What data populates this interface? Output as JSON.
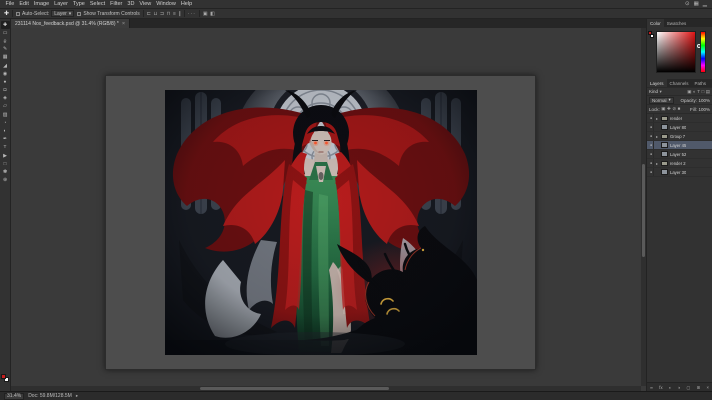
{
  "app": {
    "name": "Adobe Photoshop"
  },
  "menu_bar": {
    "items": [
      "File",
      "Edit",
      "Image",
      "Layer",
      "Type",
      "Select",
      "Filter",
      "3D",
      "View",
      "Window",
      "Help"
    ],
    "right_icons": [
      {
        "name": "search-icon",
        "glyph": "⊙"
      },
      {
        "name": "workspace-switcher-icon",
        "glyph": "▦"
      },
      {
        "name": "minimize-icon",
        "glyph": "▁"
      }
    ]
  },
  "options_bar": {
    "tool_icon_glyph": "✚",
    "auto_select_label": "Auto-Select:",
    "auto_select_value": "Layer",
    "dropdown_caret": "▾",
    "transform_label": "Show Transform Controls",
    "align_icons": [
      {
        "name": "align-left-icon",
        "glyph": "⊏"
      },
      {
        "name": "align-center-horizontal-icon",
        "glyph": "⊔"
      },
      {
        "name": "align-right-icon",
        "glyph": "⊐"
      },
      {
        "name": "align-top-icon",
        "glyph": "⊓"
      },
      {
        "name": "distribute-vertical-icon",
        "glyph": "≡"
      },
      {
        "name": "distribute-horizontal-icon",
        "glyph": "∥"
      }
    ],
    "more_options_glyph": "···",
    "extra_icons": [
      {
        "name": "3d-mode-icon",
        "glyph": "▣"
      },
      {
        "name": "arrange-icon",
        "glyph": "◧"
      }
    ]
  },
  "document_tab": {
    "title": "231114 Nox_feedback.psd @ 31.4% (RGB/8) *",
    "close_glyph": "×"
  },
  "toolbar": {
    "foreground_color": "#c61e1e",
    "background_color": "#ffffff",
    "tools": [
      {
        "name": "move-tool",
        "glyph": "✚",
        "state": "selected"
      },
      {
        "name": "marquee-tool",
        "glyph": "▭"
      },
      {
        "name": "lasso-tool",
        "glyph": "ϱ"
      },
      {
        "name": "quick-selection-tool",
        "glyph": "✎"
      },
      {
        "name": "crop-tool",
        "glyph": "▦"
      },
      {
        "name": "eyedropper-tool",
        "glyph": "◢"
      },
      {
        "name": "healing-brush-tool",
        "glyph": "◉"
      },
      {
        "name": "brush-tool",
        "glyph": "●"
      },
      {
        "name": "clone-stamp-tool",
        "glyph": "◘"
      },
      {
        "name": "history-brush-tool",
        "glyph": "◈"
      },
      {
        "name": "eraser-tool",
        "glyph": "▱"
      },
      {
        "name": "gradient-tool",
        "glyph": "▨"
      },
      {
        "name": "blur-tool",
        "glyph": "◔"
      },
      {
        "name": "dodge-tool",
        "glyph": "◐"
      },
      {
        "name": "pen-tool",
        "glyph": "✒"
      },
      {
        "name": "type-tool",
        "glyph": "T"
      },
      {
        "name": "path-selection-tool",
        "glyph": "▶"
      },
      {
        "name": "shape-tool",
        "glyph": "□"
      },
      {
        "name": "hand-tool",
        "glyph": "✽"
      },
      {
        "name": "zoom-tool",
        "glyph": "⊕"
      }
    ]
  },
  "panels": {
    "color_panel": {
      "tabs": [
        {
          "label": "Color",
          "state": "active"
        },
        {
          "label": "Swatches"
        }
      ],
      "foreground_color": "#c61e1e",
      "background_color": "#ffffff"
    },
    "layers_panel": {
      "tabs": [
        {
          "label": "Layers",
          "state": "active"
        },
        {
          "label": "Channels"
        },
        {
          "label": "Paths"
        }
      ],
      "filter_label": "Kind",
      "filter_caret": "▾",
      "filter_icons": [
        {
          "name": "filter-pixel-layers-icon",
          "glyph": "▣"
        },
        {
          "name": "filter-adjustment-layers-icon",
          "glyph": "◐"
        },
        {
          "name": "filter-type-layers-icon",
          "glyph": "T"
        },
        {
          "name": "filter-shape-layers-icon",
          "glyph": "□"
        },
        {
          "name": "filter-smart-objects-icon",
          "glyph": "▤"
        }
      ],
      "blend_mode": "Normal",
      "blend_caret": "▾",
      "opacity_label": "Opacity:",
      "opacity_value": "100%",
      "lock_label": "Lock:",
      "lock_icons": [
        {
          "name": "lock-transparency-icon",
          "glyph": "▣"
        },
        {
          "name": "lock-pixels-icon",
          "glyph": "✚"
        },
        {
          "name": "lock-position-icon",
          "glyph": "⊘"
        },
        {
          "name": "lock-all-icon",
          "glyph": "■"
        }
      ],
      "fill_label": "Fill:",
      "fill_value": "100%",
      "eye_glyph": "●",
      "group_arrow": "▸",
      "rows": [
        {
          "label": "render",
          "kind": "group"
        },
        {
          "label": "Layer 80",
          "kind": "layer"
        },
        {
          "label": "Group 7",
          "kind": "group"
        },
        {
          "label": "Layer 45",
          "kind": "layer",
          "state": "selected"
        },
        {
          "label": "Layer 52",
          "kind": "layer"
        },
        {
          "label": "render 2",
          "kind": "group"
        },
        {
          "label": "Layer 30",
          "kind": "layer"
        }
      ],
      "bottom_icons": [
        {
          "name": "link-layers-icon",
          "glyph": "∞"
        },
        {
          "name": "layer-style-icon",
          "glyph": "fx"
        },
        {
          "name": "layer-mask-icon",
          "glyph": "◐"
        },
        {
          "name": "adjustment-layer-icon",
          "glyph": "◑"
        },
        {
          "name": "new-group-icon",
          "glyph": "▢"
        },
        {
          "name": "new-layer-icon",
          "glyph": "⊞"
        },
        {
          "name": "delete-layer-icon",
          "glyph": "×"
        }
      ]
    }
  },
  "status_bar": {
    "zoom": "31.4%",
    "doc_info": "Doc: 59.8M/128.5M",
    "caret": "▸"
  }
}
